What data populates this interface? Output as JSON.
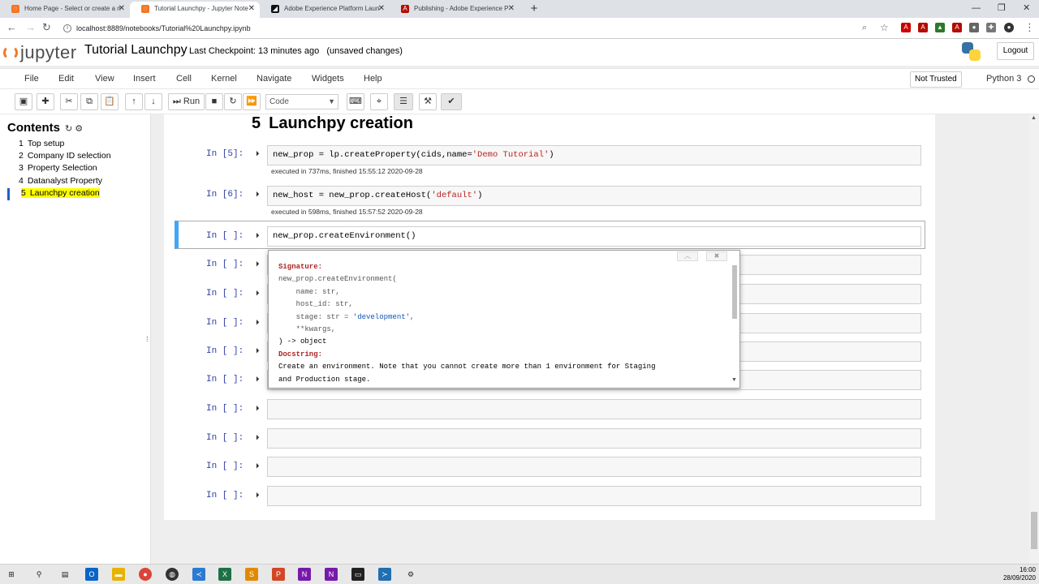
{
  "browser": {
    "tabs": [
      {
        "title": "Home Page - Select or create a n",
        "icon": "jupyter-icon",
        "color": "#f37726"
      },
      {
        "title": "Tutorial Launchpy - Jupyter Note",
        "icon": "jupyter-icon",
        "color": "#f37726"
      },
      {
        "title": "Adobe Experience Platform Laun",
        "icon": "launch-icon",
        "color": "#111111"
      },
      {
        "title": "Publishing - Adobe Experience P",
        "icon": "adobe-icon",
        "color": "#b30b00"
      }
    ],
    "url": "localhost:8889/notebooks/Tutorial%20Launchpy.ipynb"
  },
  "jupyter": {
    "logo_text": "jupyter",
    "notebook_name": "Tutorial Launchpy",
    "checkpoint": "Last Checkpoint: 13 minutes ago",
    "unsaved": "(unsaved changes)",
    "logout": "Logout",
    "menu": [
      "File",
      "Edit",
      "View",
      "Insert",
      "Cell",
      "Kernel",
      "Navigate",
      "Widgets",
      "Help"
    ],
    "not_trusted": "Not Trusted",
    "kernel": "Python 3",
    "run_label": "Run",
    "cell_type": "Code"
  },
  "toc": {
    "title": "Contents",
    "items": [
      {
        "num": "1",
        "label": "Top setup"
      },
      {
        "num": "2",
        "label": "Company ID selection"
      },
      {
        "num": "3",
        "label": "Property Selection"
      },
      {
        "num": "4",
        "label": "Datanalyst Property"
      },
      {
        "num": "5",
        "label": "Launchpy creation"
      }
    ]
  },
  "notebook": {
    "heading_num": "5",
    "heading": "Launchpy creation",
    "cells": [
      {
        "prompt": "In [5]:",
        "code_a": "new_prop = lp.createProperty(cids,name=",
        "code_s": "'Demo Tutorial'",
        "code_b": ")",
        "info": "executed in 737ms, finished 15:55:12 2020-09-28"
      },
      {
        "prompt": "In [6]:",
        "code_a": "new_host = new_prop.createHost(",
        "code_s": "'default'",
        "code_b": ")",
        "info": "executed in 598ms, finished 15:57:52 2020-09-28"
      },
      {
        "prompt": "In [ ]:",
        "code_a": "new_prop.createEnvironment",
        "code_p": "()"
      }
    ],
    "empty_prompt": "In [ ]:"
  },
  "tooltip": {
    "signature_label": "Signature:",
    "line1": "new_prop.createEnvironment(",
    "line2": "    name: str,",
    "line3": "    host_id: str,",
    "line4a": "    stage: str = ",
    "line4s": "'development'",
    "line4b": ",",
    "line5": "    **kwargs,",
    "line6": ") -> object",
    "docstring_label": "Docstring:",
    "doc1": "Create an environment. Note that you cannot create more than 1 environment for Staging",
    "doc2": "and Production stage."
  },
  "clock": {
    "time": "16:00",
    "date": "28/09/2020"
  }
}
